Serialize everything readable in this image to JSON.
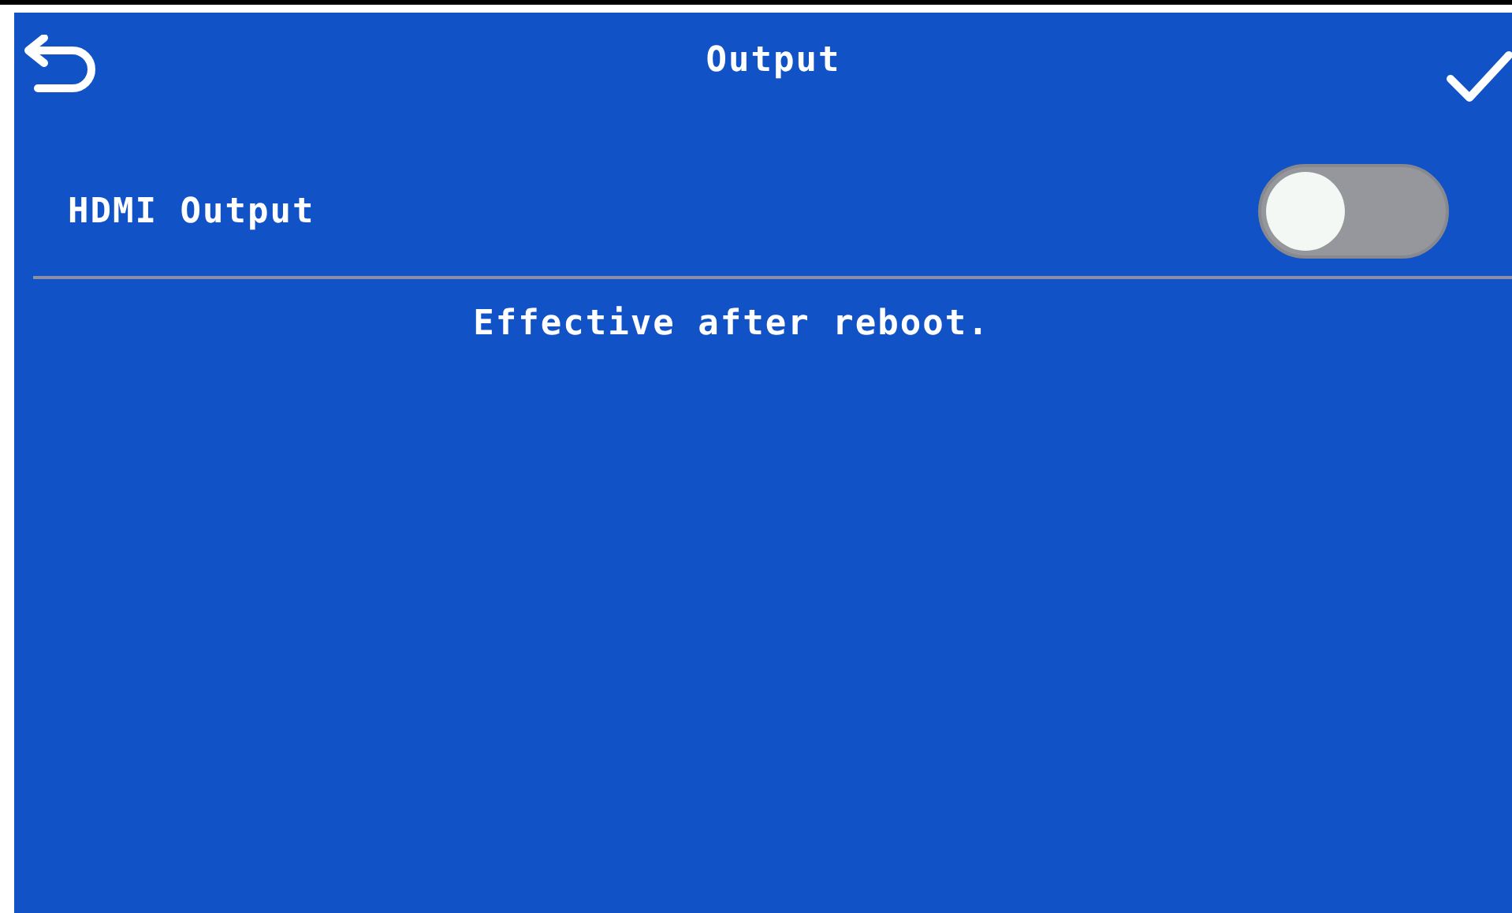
{
  "header": {
    "title": "Output"
  },
  "settings": [
    {
      "label": "HDMI Output",
      "kind": "toggle",
      "on": false
    }
  ],
  "message": "Effective after reboot."
}
